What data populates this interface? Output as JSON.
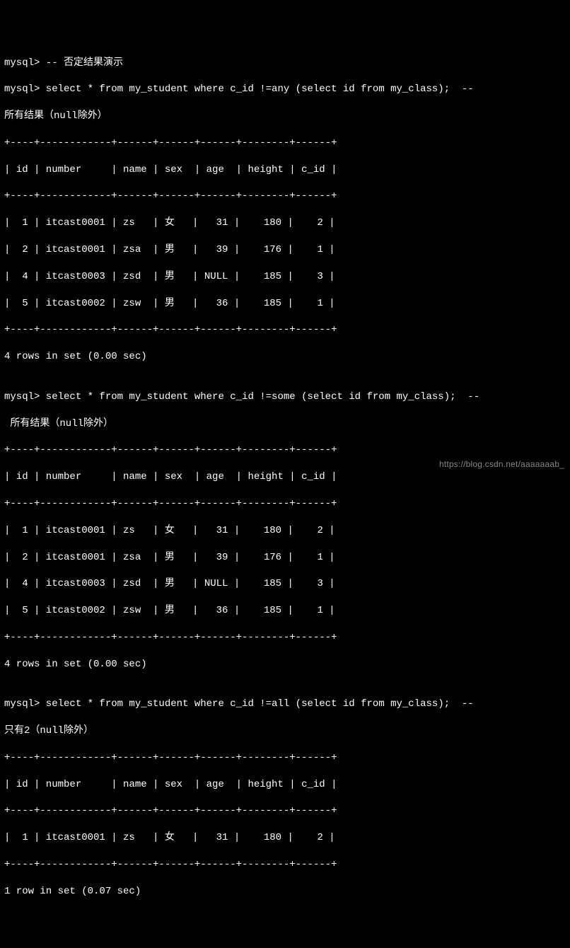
{
  "lines": {
    "l01": "mysql> -- 否定结果演示",
    "l02": "mysql> select * from my_student where c_id !=any (select id from my_class);  --",
    "l03": "所有结果（null除外）",
    "l04": "+----+------------+------+------+------+--------+------+",
    "l05": "| id | number     | name | sex  | age  | height | c_id |",
    "l06": "+----+------------+------+------+------+--------+------+",
    "l07": "|  1 | itcast0001 | zs   | 女   |   31 |    180 |    2 |",
    "l08": "|  2 | itcast0001 | zsa  | 男   |   39 |    176 |    1 |",
    "l09": "|  4 | itcast0003 | zsd  | 男   | NULL |    185 |    3 |",
    "l10": "|  5 | itcast0002 | zsw  | 男   |   36 |    185 |    1 |",
    "l11": "+----+------------+------+------+------+--------+------+",
    "l12": "4 rows in set (0.00 sec)",
    "l13": "",
    "l14": "mysql> select * from my_student where c_id !=some (select id from my_class);  --",
    "l15": " 所有结果（null除外）",
    "l16": "+----+------------+------+------+------+--------+------+",
    "l17": "| id | number     | name | sex  | age  | height | c_id |",
    "l18": "+----+------------+------+------+------+--------+------+",
    "l19": "|  1 | itcast0001 | zs   | 女   |   31 |    180 |    2 |",
    "l20": "|  2 | itcast0001 | zsa  | 男   |   39 |    176 |    1 |",
    "l21": "|  4 | itcast0003 | zsd  | 男   | NULL |    185 |    3 |",
    "l22": "|  5 | itcast0002 | zsw  | 男   |   36 |    185 |    1 |",
    "l23": "+----+------------+------+------+------+--------+------+",
    "l24": "4 rows in set (0.00 sec)",
    "l25": "",
    "l26": "mysql> select * from my_student where c_id !=all (select id from my_class);  --",
    "l27": "只有2（null除外）",
    "l28": "+----+------------+------+------+------+--------+------+",
    "l29": "| id | number     | name | sex  | age  | height | c_id |",
    "l30": "+----+------------+------+------+------+--------+------+",
    "l31": "|  1 | itcast0001 | zs   | 女   |   31 |    180 |    2 |",
    "l32": "+----+------------+------+------+------+--------+------+",
    "l33": "1 row in set (0.07 sec)"
  },
  "watermark": "https://blog.csdn.net/aaaaaaab_",
  "chart_data": [
    {
      "type": "table",
      "title": "select * from my_student where c_id !=any (select id from my_class)",
      "note": "所有结果（null除外）",
      "columns": [
        "id",
        "number",
        "name",
        "sex",
        "age",
        "height",
        "c_id"
      ],
      "rows": [
        [
          1,
          "itcast0001",
          "zs",
          "女",
          31,
          180,
          2
        ],
        [
          2,
          "itcast0001",
          "zsa",
          "男",
          39,
          176,
          1
        ],
        [
          4,
          "itcast0003",
          "zsd",
          "男",
          null,
          185,
          3
        ],
        [
          5,
          "itcast0002",
          "zsw",
          "男",
          36,
          185,
          1
        ]
      ],
      "footer": "4 rows in set (0.00 sec)"
    },
    {
      "type": "table",
      "title": "select * from my_student where c_id !=some (select id from my_class)",
      "note": "所有结果（null除外）",
      "columns": [
        "id",
        "number",
        "name",
        "sex",
        "age",
        "height",
        "c_id"
      ],
      "rows": [
        [
          1,
          "itcast0001",
          "zs",
          "女",
          31,
          180,
          2
        ],
        [
          2,
          "itcast0001",
          "zsa",
          "男",
          39,
          176,
          1
        ],
        [
          4,
          "itcast0003",
          "zsd",
          "男",
          null,
          185,
          3
        ],
        [
          5,
          "itcast0002",
          "zsw",
          "男",
          36,
          185,
          1
        ]
      ],
      "footer": "4 rows in set (0.00 sec)"
    },
    {
      "type": "table",
      "title": "select * from my_student where c_id !=all (select id from my_class)",
      "note": "只有2（null除外）",
      "columns": [
        "id",
        "number",
        "name",
        "sex",
        "age",
        "height",
        "c_id"
      ],
      "rows": [
        [
          1,
          "itcast0001",
          "zs",
          "女",
          31,
          180,
          2
        ]
      ],
      "footer": "1 row in set (0.07 sec)"
    }
  ]
}
